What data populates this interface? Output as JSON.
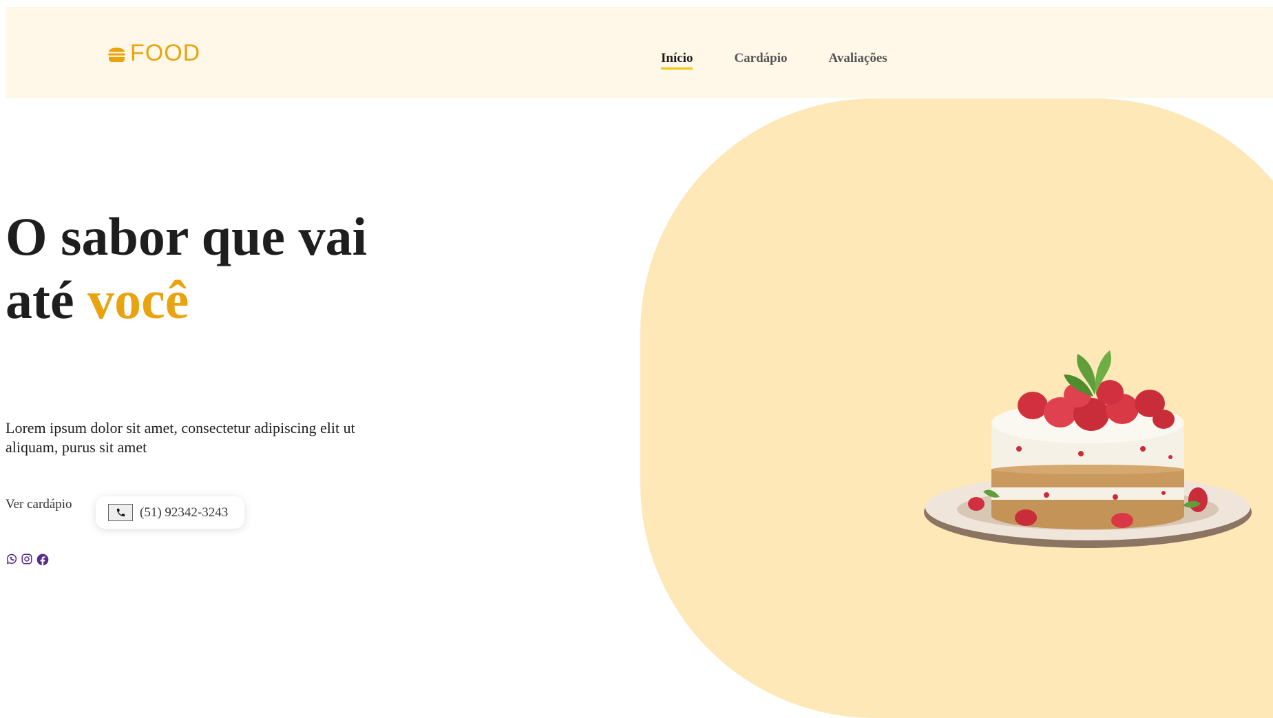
{
  "brand": {
    "name": "FOOD",
    "icon": "burger-icon",
    "color": "#e9a30f"
  },
  "nav": [
    {
      "label": "Início",
      "active": true
    },
    {
      "label": "Cardápio",
      "active": false
    },
    {
      "label": "Avaliações",
      "active": false
    }
  ],
  "hero": {
    "title_line1": "O sabor que vai",
    "title_line2_prefix": "até",
    "title_accent": "você",
    "description": "Lorem ipsum dolor sit amet, consectetur adipiscing elit ut aliquam, purus sit amet",
    "cta_label": "Ver cardápio",
    "phone": "(51) 92342-3243",
    "phone_icon": "phone-icon",
    "image_icon": "strawberry-cake-image"
  },
  "socials": [
    {
      "icon": "whatsapp-icon"
    },
    {
      "icon": "instagram-icon"
    },
    {
      "icon": "facebook-icon"
    }
  ],
  "colors": {
    "header_bg": "#fff8e8",
    "hero_shape": "#fee8b7",
    "accent": "#e9a30f",
    "nav_underline": "#f2c40f",
    "social": "#5a2b8f"
  }
}
